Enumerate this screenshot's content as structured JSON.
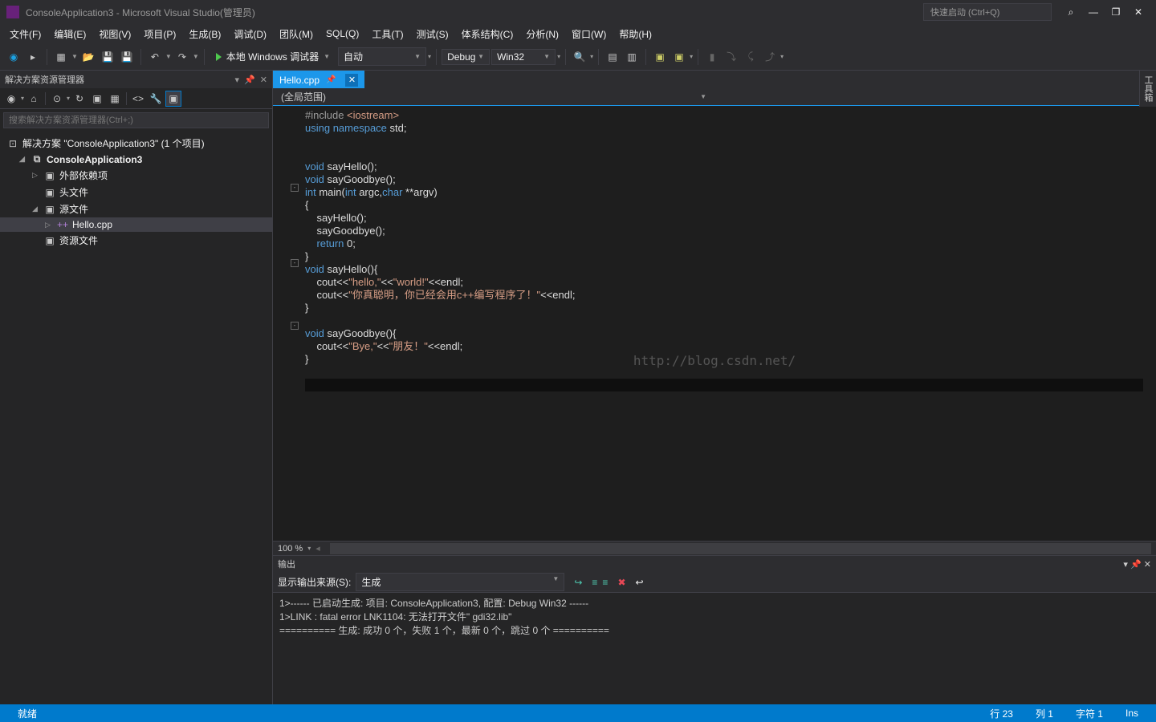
{
  "title": "ConsoleApplication3 - Microsoft Visual Studio(管理员)",
  "quick_launch_placeholder": "快速启动 (Ctrl+Q)",
  "menu": {
    "file": "文件(F)",
    "edit": "编辑(E)",
    "view": "视图(V)",
    "project": "项目(P)",
    "build": "生成(B)",
    "debug": "调试(D)",
    "team": "团队(M)",
    "sql": "SQL(Q)",
    "tools": "工具(T)",
    "test": "测试(S)",
    "architecture": "体系结构(C)",
    "analyze": "分析(N)",
    "window": "窗口(W)",
    "help": "帮助(H)"
  },
  "toolbar": {
    "start_label": "本地 Windows 调试器",
    "config_auto": "自动",
    "config_debug": "Debug",
    "config_platform": "Win32"
  },
  "solution_explorer": {
    "title": "解决方案资源管理器",
    "search_placeholder": "搜索解决方案资源管理器(Ctrl+;)",
    "solution": "解决方案 \"ConsoleApplication3\" (1 个项目)",
    "project": "ConsoleApplication3",
    "external_deps": "外部依赖项",
    "headers": "头文件",
    "sources": "源文件",
    "hello_cpp": "Hello.cpp",
    "resources": "资源文件"
  },
  "tab": {
    "name": "Hello.cpp"
  },
  "nav": {
    "scope": "(全局范围)"
  },
  "zoom": "100 %",
  "output": {
    "title": "输出",
    "source_label": "显示输出来源(S):",
    "source_value": "生成",
    "lines": [
      "1>------ 已启动生成: 项目: ConsoleApplication3, 配置: Debug Win32 ------",
      "1>LINK : fatal error LNK1104: 无法打开文件\" gdi32.lib\"",
      "========== 生成: 成功 0 个，失败 1 个，最新 0 个，跳过 0 个 =========="
    ]
  },
  "status": {
    "ready": "就绪",
    "line": "行 23",
    "col": "列 1",
    "char": "字符 1",
    "ins": "Ins"
  },
  "watermark": "http://blog.csdn.net/",
  "right_tab": "工具箱",
  "code": {
    "l1_pre": "#include ",
    "l1_inc": "<iostream>",
    "l2a": "using",
    "l2b": " namespace",
    "l2c": " std;",
    "l4a": "void",
    "l4b": " sayHello();",
    "l5a": "void",
    "l5b": " sayGoodbye();",
    "l6a": "int",
    "l6b": " main(",
    "l6c": "int",
    "l6d": " argc,",
    "l6e": "char",
    "l6f": " **argv)",
    "l7": "{",
    "l8": "    sayHello();",
    "l9": "    sayGoodbye();",
    "l10a": "    return",
    "l10b": " 0;",
    "l11": "}",
    "l12a": "void",
    "l12b": " sayHello(){",
    "l13a": "    cout<<",
    "l13b": "\"hello,\"",
    "l13c": "<<",
    "l13d": "\"world!\"",
    "l13e": "<<endl;",
    "l14a": "    cout<<",
    "l14b": "\"你真聪明，你已经会用c++编写程序了！\"",
    "l14c": "<<endl;",
    "l15": "}",
    "l17a": "void",
    "l17b": " sayGoodbye(){",
    "l18a": "    cout<<",
    "l18b": "\"Bye,\"",
    "l18c": "<<",
    "l18d": "\"朋友！\"",
    "l18e": "<<endl;",
    "l19": "}"
  }
}
